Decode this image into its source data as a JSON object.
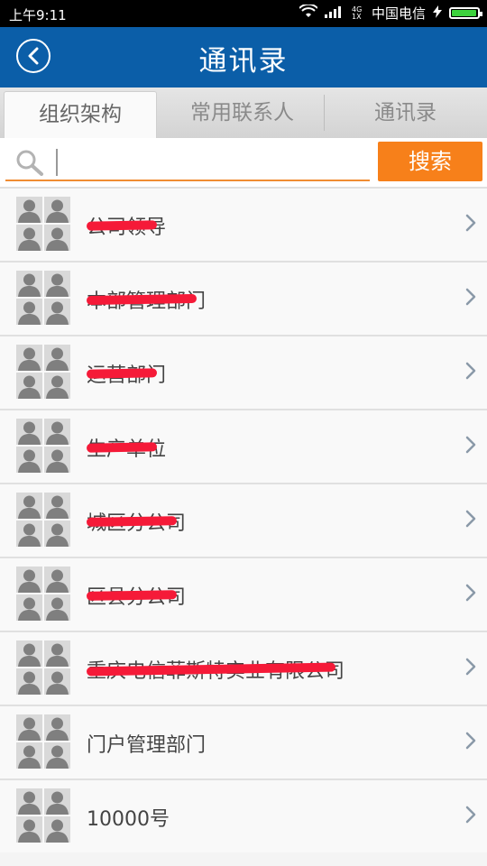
{
  "status_bar": {
    "time": "上午9:11",
    "net_label": "4G 1X",
    "carrier": "中国电信",
    "battery_level": 0.95
  },
  "header": {
    "title": "通讯录"
  },
  "tabs": [
    {
      "label": "组织架构",
      "active": true
    },
    {
      "label": "常用联系人",
      "active": false
    },
    {
      "label": "通讯录",
      "active": false
    }
  ],
  "search": {
    "placeholder": "",
    "button_label": "搜索"
  },
  "list": [
    {
      "label": "公司领导",
      "redacted": true
    },
    {
      "label": "本部管理部门",
      "redacted": true
    },
    {
      "label": "运营部门",
      "redacted": true
    },
    {
      "label": "生产单位",
      "redacted": true
    },
    {
      "label": "城区分公司",
      "redacted": true
    },
    {
      "label": "区县分公司",
      "redacted": true
    },
    {
      "label": "重庆电信菲斯特实业有限公司",
      "redacted": true
    },
    {
      "label": "门户管理部门",
      "redacted": false
    },
    {
      "label": "10000号",
      "redacted": false
    }
  ],
  "colors": {
    "header_bg": "#0b5ea8",
    "accent_orange": "#f7801a",
    "redaction_red": "#f51a38"
  }
}
